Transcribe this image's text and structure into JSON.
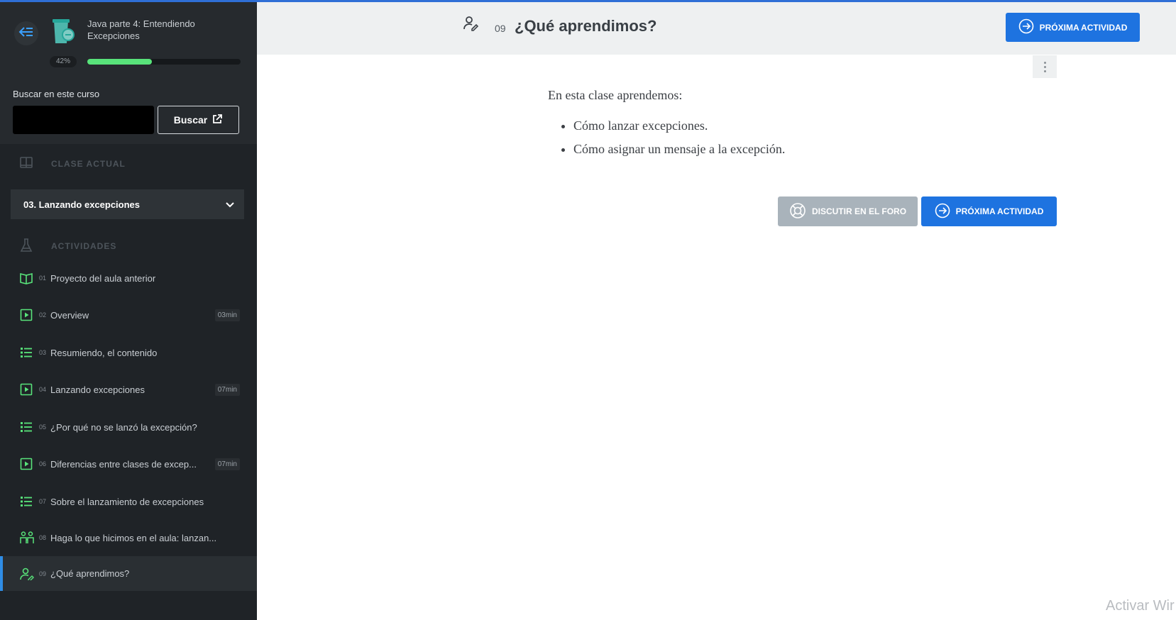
{
  "course": {
    "title": "Java parte 4: Entendiendo Excepciones",
    "progress_label": "42%",
    "progress": 0.42
  },
  "search": {
    "label": "Buscar en este curso",
    "placeholder": "",
    "button_label": "Buscar"
  },
  "current_class": {
    "section_label": "CLASE ACTUAL",
    "selected": "03. Lanzando excepciones"
  },
  "activities": {
    "section_label": "ACTIVIDADES",
    "items": [
      {
        "num": "01",
        "label": "Proyecto del aula anterior",
        "icon": "book-icon",
        "duration": ""
      },
      {
        "num": "02",
        "label": "Overview",
        "icon": "video-icon",
        "duration": "03min"
      },
      {
        "num": "03",
        "label": "Resumiendo, el contenido",
        "icon": "list-icon",
        "duration": ""
      },
      {
        "num": "04",
        "label": "Lanzando excepciones",
        "icon": "video-icon",
        "duration": "07min"
      },
      {
        "num": "05",
        "label": "¿Por qué no se lanzó la excepción?",
        "icon": "list-icon",
        "duration": ""
      },
      {
        "num": "06",
        "label": "Diferencias entre clases de excep...",
        "icon": "video-icon",
        "duration": "07min"
      },
      {
        "num": "07",
        "label": "Sobre el lanzamiento de excepciones",
        "icon": "list-icon",
        "duration": ""
      },
      {
        "num": "08",
        "label": "Haga lo que hicimos en el aula: lanzan...",
        "icon": "people-icon",
        "duration": ""
      },
      {
        "num": "09",
        "label": "¿Qué aprendimos?",
        "icon": "user-edit-icon",
        "duration": ""
      }
    ]
  },
  "header": {
    "num": "09",
    "title": "¿Qué aprendimos?",
    "next_button": "PRÓXIMA ACTIVIDAD"
  },
  "content": {
    "intro": "En esta clase aprendemos:",
    "bullets": [
      "Cómo lanzar excepciones.",
      "Cómo asignar un mensaje a la excepción."
    ]
  },
  "actions": {
    "forum_button": "DISCUTIR EN EL FORO",
    "next_button": "PRÓXIMA ACTIVIDAD"
  },
  "watermark": "Activar Wir",
  "colors": {
    "accent": "#1e73e0",
    "sidebar_bg": "#1f2327",
    "icon_green": "#58e37a",
    "progress": "#58e37a"
  }
}
